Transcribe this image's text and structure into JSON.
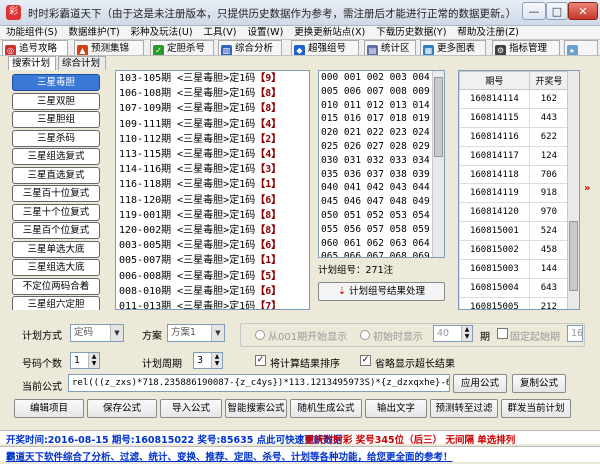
{
  "window": {
    "title": "时时彩霸道天下（由于这是未注册版本，只提供历史数据作为参考，需注册后才能进行正常的数据更新。）",
    "min": "—",
    "max": "□",
    "close": "✕"
  },
  "menu": [
    "功能组件(S)",
    "数据维护(T)",
    "彩种及玩法(U)",
    "工具(V)",
    "设置(W)",
    "更换更新站点(X)",
    "下载历史数据(Y)",
    "帮助及注册(Z)"
  ],
  "toolbar": [
    {
      "label": "追号攻略",
      "icon": "red-target-icon",
      "color": "#d03030",
      "glyph": "◎"
    },
    {
      "label": "预测集锦",
      "icon": "chart-icon",
      "color": "#d04010",
      "glyph": "▲"
    },
    {
      "label": "定胆杀号",
      "icon": "green-check-icon",
      "color": "#2a9a2a",
      "glyph": "✓"
    },
    {
      "label": "综合分析",
      "icon": "bar-chart-icon",
      "color": "#3060c0",
      "glyph": "▥"
    },
    {
      "label": "超强组号",
      "icon": "diamond-icon",
      "color": "#2060d0",
      "glyph": "◆"
    },
    {
      "label": "统计区",
      "icon": "stats-icon",
      "color": "#6070a0",
      "glyph": "▤"
    },
    {
      "label": "更多图表",
      "icon": "more-charts-icon",
      "color": "#3080c0",
      "glyph": "▦"
    },
    {
      "label": "指标管理",
      "icon": "gear-icon",
      "color": "#404040",
      "glyph": "⚙"
    }
  ],
  "subtabs": [
    "搜索计划",
    "综合计划"
  ],
  "plan_types": [
    "三星毒胆",
    "三星双胆",
    "三星胆组",
    "三星杀码",
    "三星组选复式",
    "三星直选复式",
    "三星百十位复式",
    "三星十个位复式",
    "三星百个位复式",
    "三星单选大底",
    "三星组选大底",
    "不定位两码合着",
    "三星组六定胆"
  ],
  "selected_plan_index": 0,
  "plans": [
    {
      "text": "103-105期 <三星毒胆>定1码",
      "tag": "【9】"
    },
    {
      "text": "106-108期 <三星毒胆>定1码",
      "tag": "【8】"
    },
    {
      "text": "107-109期 <三星毒胆>定1码",
      "tag": "【8】"
    },
    {
      "text": "109-111期 <三星毒胆>定1码",
      "tag": "【4】"
    },
    {
      "text": "110-112期 <三星毒胆>定1码",
      "tag": "【2】"
    },
    {
      "text": "113-115期 <三星毒胆>定1码",
      "tag": "【4】"
    },
    {
      "text": "114-116期 <三星毒胆>定1码",
      "tag": "【3】"
    },
    {
      "text": "116-118期 <三星毒胆>定1码",
      "tag": "【1】"
    },
    {
      "text": "118-120期 <三星毒胆>定1码",
      "tag": "【6】"
    },
    {
      "text": "119-001期 <三星毒胆>定1码",
      "tag": "【8】"
    },
    {
      "text": "120-002期 <三星毒胆>定1码",
      "tag": "【8】"
    },
    {
      "text": "003-005期 <三星毒胆>定1码",
      "tag": "【6】"
    },
    {
      "text": "005-007期 <三星毒胆>定1码",
      "tag": "【1】"
    },
    {
      "text": "006-008期 <三星毒胆>定1码",
      "tag": "【5】"
    },
    {
      "text": "008-010期 <三星毒胆>定1码",
      "tag": "【6】"
    },
    {
      "text": "011-013期 <三星毒胆>定1码",
      "tag": "【7】"
    }
  ],
  "codes": [
    "000 001 002 003 004",
    "005 006 007 008 009",
    "010 011 012 013 014",
    "015 016 017 018 019",
    "020 021 022 023 024",
    "025 026 027 028 029",
    "030 031 032 033 034",
    "035 036 037 038 039",
    "040 041 042 043 044",
    "045 046 047 048 049",
    "050 051 052 053 054",
    "055 056 057 058 059",
    "060 061 062 063 064",
    "065 066 067 068 069"
  ],
  "plan_count": "计划组号：271注",
  "process_button": "计划组号结果处理",
  "results": {
    "headers": [
      "期号",
      "开奖号"
    ],
    "rows": [
      [
        "160814114",
        "162"
      ],
      [
        "160814115",
        "443"
      ],
      [
        "160814116",
        "622"
      ],
      [
        "160814117",
        "124"
      ],
      [
        "160814118",
        "706"
      ],
      [
        "160814119",
        "918"
      ],
      [
        "160814120",
        "970"
      ],
      [
        "160815001",
        "524"
      ],
      [
        "160815002",
        "458"
      ],
      [
        "160815003",
        "144"
      ],
      [
        "160815004",
        "643"
      ],
      [
        "160815005",
        "212"
      ]
    ]
  },
  "side_arrows": "»",
  "form": {
    "plan_method_label": "计划方式",
    "plan_method_value": "定码",
    "scheme_label": "方案",
    "scheme_value": "方案1",
    "radio_from_001": "从001期开始显示",
    "radio_initial": "初始时显示",
    "initial_value": "40",
    "period_unit": "期",
    "fixed_start_label": "固定起始期",
    "fixed_start_value": "16",
    "code_count_label": "号码个数",
    "code_count_value": "1",
    "plan_period_label": "计划周期",
    "plan_period_value": "3",
    "sort_label": "将计算结果排序",
    "sort_checked": "✓",
    "omit_label": "省略显示超长结果",
    "omit_checked": "✓",
    "formula_label": "当前公式",
    "formula_value": "rel(((z_zxs)*718.235886190087-{z_c4ys})*113.1213495973S)*{z_dzxqxhe}-605.127535061911),1)",
    "apply_button": "应用公式",
    "copy_button": "复制公式"
  },
  "actions": [
    "编辑项目",
    "保存公式",
    "导入公式",
    "智能搜索公式",
    "随机生成公式",
    "输出文字",
    "预测转至过滤",
    "群发当前计划"
  ],
  "status": {
    "line1_left": "开奖时间:2016-08-15 期号:160815022 奖号:85635 点此可快速更新数据",
    "line1_right": "重庆时时彩  奖号345位（后三） 无间隔  单选排列",
    "line2": "霸道天下软件综合了分析、过滤、统计、变换、推荐、定胆、杀号、计划等各种功能，给您更全面的参考！"
  }
}
